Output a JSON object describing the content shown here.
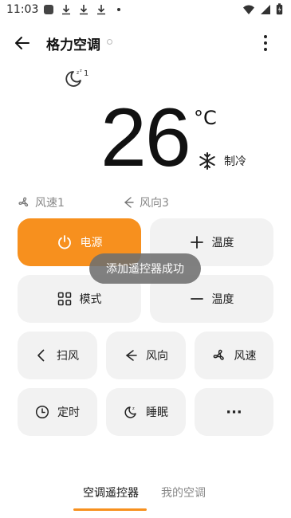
{
  "status_bar": {
    "time": "11:03"
  },
  "app_bar": {
    "title": "格力空调"
  },
  "ac": {
    "temperature": "26",
    "unit": "°C",
    "mode": "制冷",
    "fan_speed": "风速1",
    "fan_direction": "风向3"
  },
  "buttons": {
    "power": "电源",
    "temp_up": "温度",
    "mode": "模式",
    "temp_down": "温度",
    "swing": "扫风",
    "direction": "风向",
    "speed": "风速",
    "timer": "定时",
    "sleep": "睡眠",
    "more": "···"
  },
  "toast": "添加遥控器成功",
  "tabs": [
    {
      "label": "空调遥控器",
      "active": true
    },
    {
      "label": "我的空调",
      "active": false
    }
  ],
  "colors": {
    "accent": "#f7901e",
    "button_bg": "#f2f2f2"
  }
}
